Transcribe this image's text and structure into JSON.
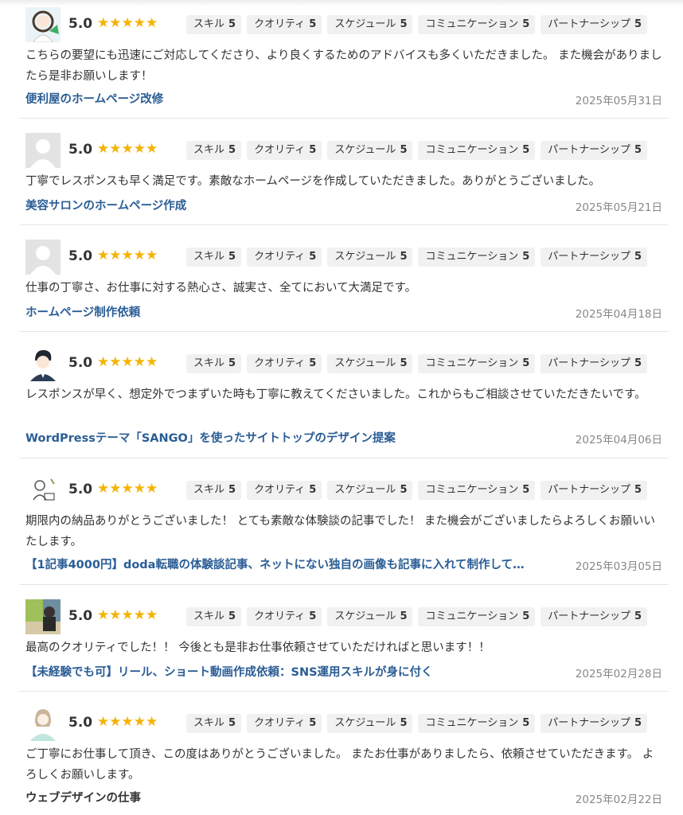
{
  "badge_labels": [
    "スキル",
    "クオリティ",
    "スケジュール",
    "コミュニケーション",
    "パートナーシップ"
  ],
  "reviews": [
    {
      "avatar": "woman-illustration-avatar",
      "score": "5.0",
      "stars": "★★★★★",
      "badges": [
        {
          "label": "スキル",
          "value": "5"
        },
        {
          "label": "クオリティ",
          "value": "5"
        },
        {
          "label": "スケジュール",
          "value": "5"
        },
        {
          "label": "コミュニケーション",
          "value": "5"
        },
        {
          "label": "パートナーシップ",
          "value": "5"
        }
      ],
      "comment": "こちらの要望にも迅速にご対応してくださり、より良くするためのアドバイスも多くいただきました。 また機会がありましたら是非お願いします！",
      "job": "便利屋のホームページ改修",
      "date": "2025年05月31日"
    },
    {
      "avatar": "default-user-avatar",
      "score": "5.0",
      "stars": "★★★★★",
      "badges": [
        {
          "label": "スキル",
          "value": "5"
        },
        {
          "label": "クオリティ",
          "value": "5"
        },
        {
          "label": "スケジュール",
          "value": "5"
        },
        {
          "label": "コミュニケーション",
          "value": "5"
        },
        {
          "label": "パートナーシップ",
          "value": "5"
        }
      ],
      "comment": "丁寧でレスポンスも早く満足です。素敵なホームページを作成していただきました。ありがとうございました。",
      "job": "美容サロンのホームページ作成",
      "date": "2025年05月21日"
    },
    {
      "avatar": "default-user-avatar",
      "score": "5.0",
      "stars": "★★★★★",
      "badges": [
        {
          "label": "スキル",
          "value": "5"
        },
        {
          "label": "クオリティ",
          "value": "5"
        },
        {
          "label": "スケジュール",
          "value": "5"
        },
        {
          "label": "コミュニケーション",
          "value": "5"
        },
        {
          "label": "パートナーシップ",
          "value": "5"
        }
      ],
      "comment": "仕事の丁寧さ、お仕事に対する熱心さ、誠実さ、全てにおいて大満足です。",
      "job": "ホームページ制作依頼",
      "date": "2025年04月18日"
    },
    {
      "avatar": "man-illustration-avatar",
      "score": "5.0",
      "stars": "★★★★★",
      "badges": [
        {
          "label": "スキル",
          "value": "5"
        },
        {
          "label": "クオリティ",
          "value": "5"
        },
        {
          "label": "スケジュール",
          "value": "5"
        },
        {
          "label": "コミュニケーション",
          "value": "5"
        },
        {
          "label": "パートナーシップ",
          "value": "5"
        }
      ],
      "comment": "レスポンスが早く、想定外でつまずいた時も丁寧に教えてくださいました。これからもご相談させていただきたいです。",
      "job": "WordPressテーマ「SANGO」を使ったサイトトップのデザイン提案",
      "date": "2025年04月06日"
    },
    {
      "avatar": "sketch-person-avatar",
      "score": "5.0",
      "stars": "★★★★★",
      "badges": [
        {
          "label": "スキル",
          "value": "5"
        },
        {
          "label": "クオリティ",
          "value": "5"
        },
        {
          "label": "スケジュール",
          "value": "5"
        },
        {
          "label": "コミュニケーション",
          "value": "5"
        },
        {
          "label": "パートナーシップ",
          "value": "5"
        }
      ],
      "comment": "期限内の納品ありがとうございました！ とても素敵な体験談の記事でした！ また機会がございましたらよろしくお願いいたします。",
      "job": "【1記事4000円】doda転職の体験談記事、ネットにない独自の画像も記事に入れて制作して…",
      "date": "2025年03月05日"
    },
    {
      "avatar": "photo-person-avatar",
      "score": "5.0",
      "stars": "★★★★★",
      "badges": [
        {
          "label": "スキル",
          "value": "5"
        },
        {
          "label": "クオリティ",
          "value": "5"
        },
        {
          "label": "スケジュール",
          "value": "5"
        },
        {
          "label": "コミュニケーション",
          "value": "5"
        },
        {
          "label": "パートナーシップ",
          "value": "5"
        }
      ],
      "comment": "最高のクオリティでした！！ 今後とも是非お仕事依頼させていただければと思います！！",
      "job": "【未経験でも可】リール、ショート動画作成依頼：SNS運用スキルが身に付く",
      "date": "2025年02月28日"
    },
    {
      "avatar": "watercolor-woman-avatar",
      "score": "5.0",
      "stars": "★★★★★",
      "badges": [
        {
          "label": "スキル",
          "value": "5"
        },
        {
          "label": "クオリティ",
          "value": "5"
        },
        {
          "label": "スケジュール",
          "value": "5"
        },
        {
          "label": "コミュニケーション",
          "value": "5"
        },
        {
          "label": "パートナーシップ",
          "value": "5"
        }
      ],
      "comment": "ご丁寧にお仕事して頂き、この度はありがとうございました。 またお仕事がありましたら、依頼させていただきます。 よろしくお願いします。",
      "job": "ウェブデザインの仕事",
      "date": "2025年02月22日"
    }
  ]
}
